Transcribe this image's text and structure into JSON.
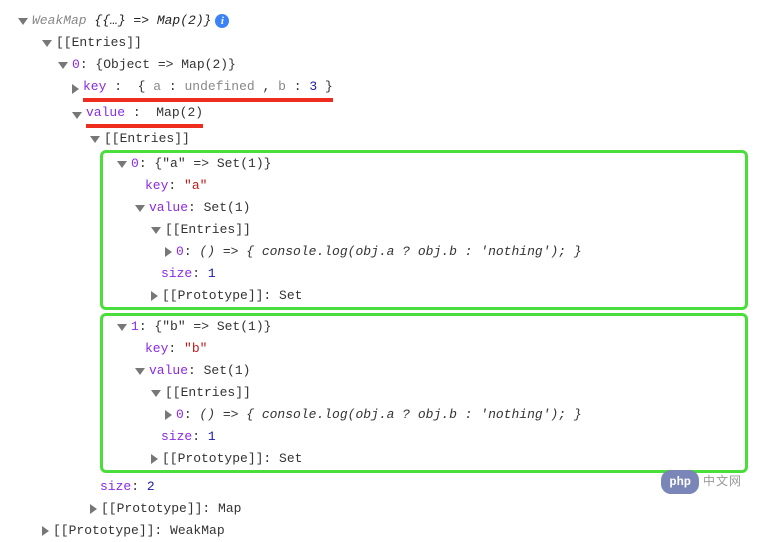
{
  "root": {
    "type": "WeakMap",
    "preview": "{{…} => Map(2)}",
    "entries_label": "[[Entries]]",
    "prototype_label": "[[Prototype]]",
    "prototype_value": "WeakMap"
  },
  "entry0": {
    "index": "0",
    "preview": "{Object => Map(2)}",
    "key_label": "key",
    "key_preview_open": "{",
    "key_a_name": "a",
    "key_a_sep": ": ",
    "key_a_value": "undefined",
    "key_sep": ", ",
    "key_b_name": "b",
    "key_b_sep": ": ",
    "key_b_value": "3",
    "key_preview_close": "}",
    "value_label": "value",
    "value_preview": "Map(2)"
  },
  "map": {
    "entries_label": "[[Entries]]",
    "size_label": "size",
    "size_value": "2",
    "prototype_label": "[[Prototype]]",
    "prototype_value": "Map"
  },
  "mapEntry0": {
    "index": "0",
    "preview": "{\"a\" => Set(1)}",
    "key_label": "key",
    "key_value": "\"a\"",
    "value_label": "value",
    "value_preview": "Set(1)",
    "entries_label": "[[Entries]]",
    "fn_index": "0",
    "fn_text": "() => { console.log(obj.a ? obj.b : 'nothing'); }",
    "size_label": "size",
    "size_value": "1",
    "prototype_label": "[[Prototype]]",
    "prototype_value": "Set"
  },
  "mapEntry1": {
    "index": "1",
    "preview": "{\"b\" => Set(1)}",
    "key_label": "key",
    "key_value": "\"b\"",
    "value_label": "value",
    "value_preview": "Set(1)",
    "entries_label": "[[Entries]]",
    "fn_index": "0",
    "fn_text": "() => { console.log(obj.a ? obj.b : 'nothing'); }",
    "size_label": "size",
    "size_value": "1",
    "prototype_label": "[[Prototype]]",
    "prototype_value": "Set"
  },
  "watermark": {
    "badge": "php",
    "text": "中文网"
  }
}
